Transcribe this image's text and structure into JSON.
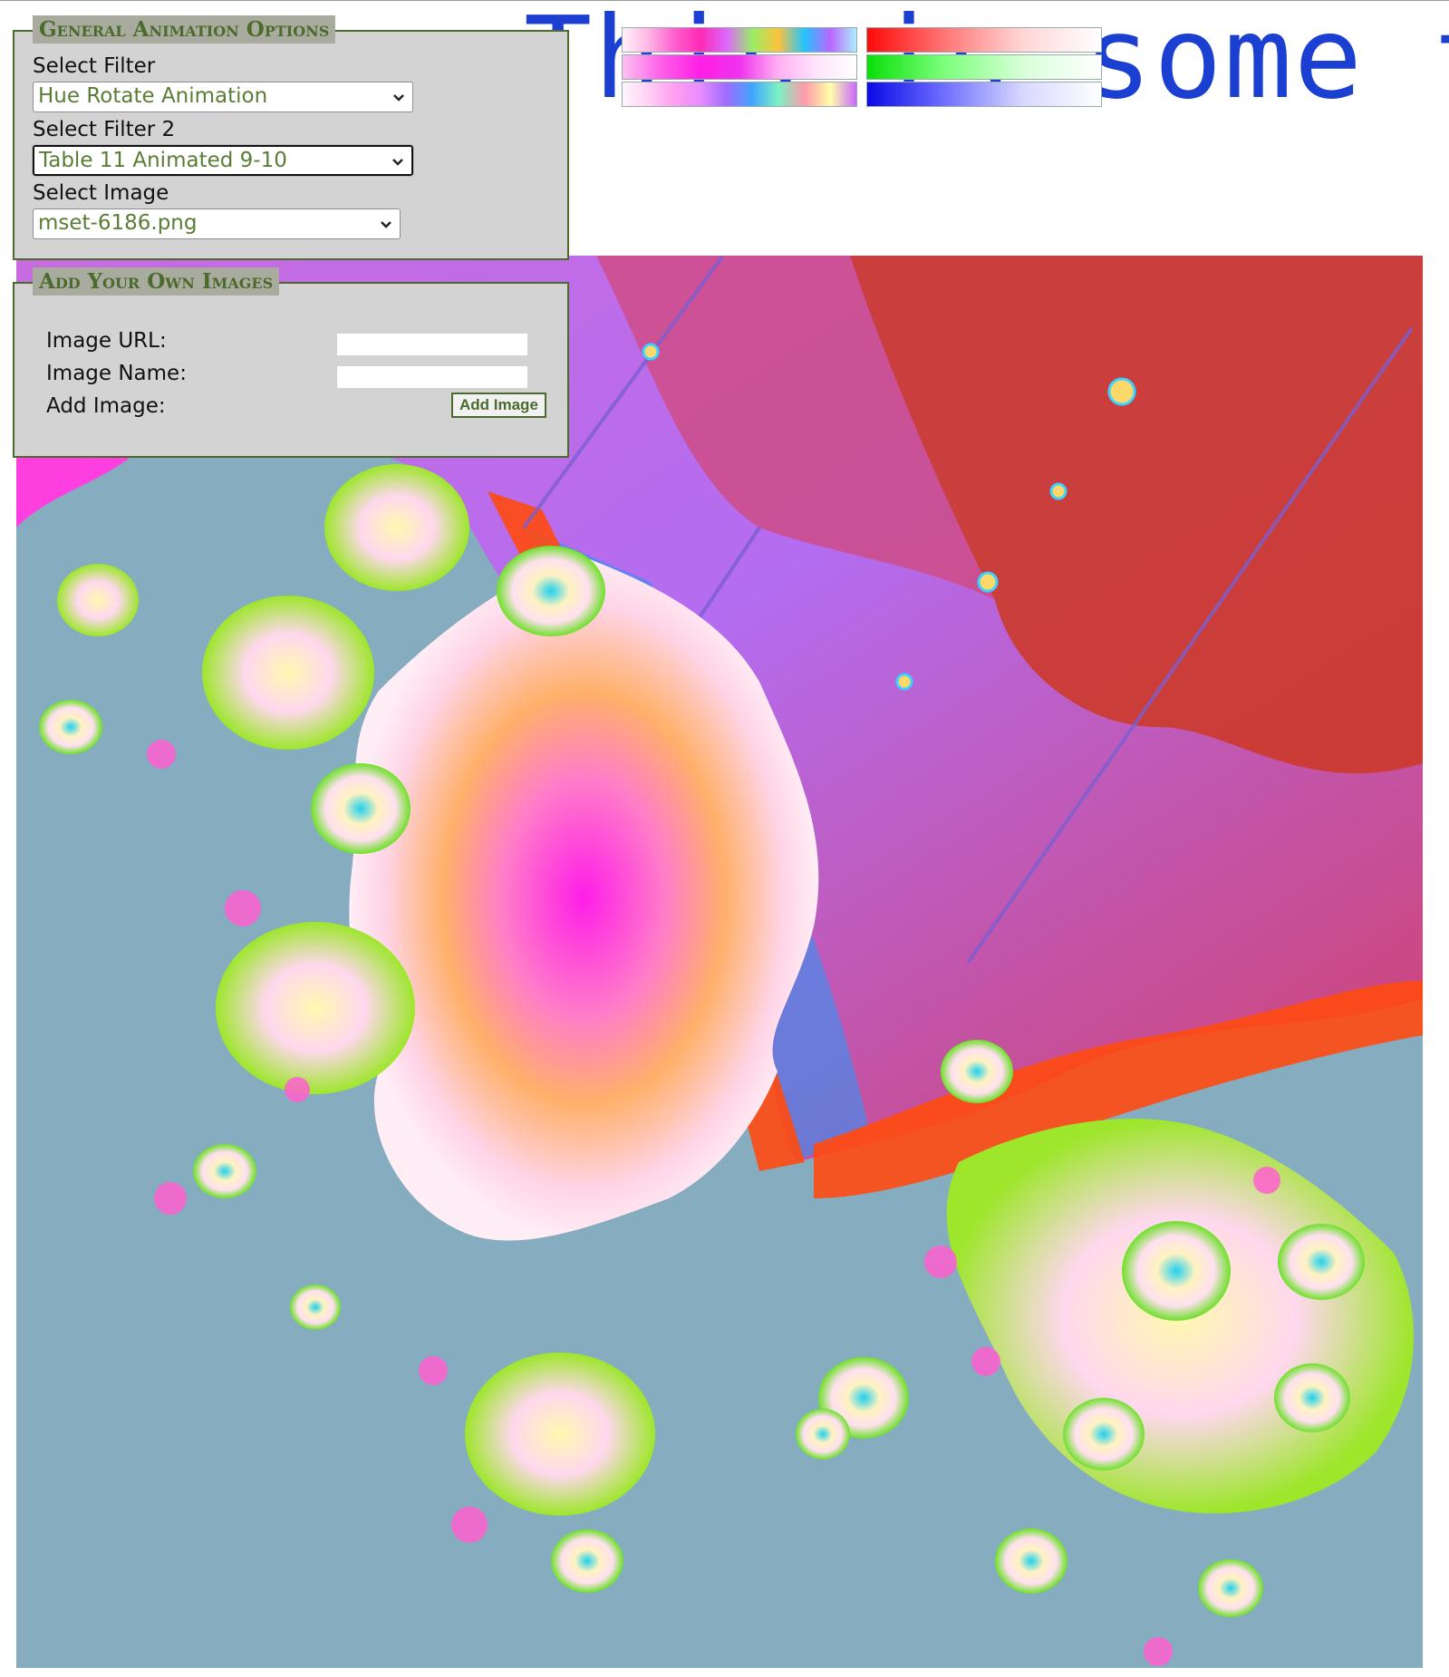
{
  "banner": {
    "text": "This is some t"
  },
  "general_panel": {
    "legend": "General Animation Options",
    "filter_label": "Select Filter",
    "filter_value": "Hue Rotate Animation",
    "filter2_label": "Select Filter 2",
    "filter2_value": "Table 11 Animated 9-10",
    "image_label": "Select Image",
    "image_value": "mset-6186.png"
  },
  "add_panel": {
    "legend": "Add Your Own Images",
    "url_label": "Image URL:",
    "url_value": "",
    "name_label": "Image Name:",
    "name_value": "",
    "add_label": "Add Image:",
    "add_button": "Add Image"
  },
  "icons": [
    "chevron-down-icon"
  ],
  "colors": {
    "panel_bg": "#d3d3d3",
    "accent": "#4a6b2b",
    "banner_text": "#1b3fd0",
    "fractal_bg": "#86adbf"
  }
}
